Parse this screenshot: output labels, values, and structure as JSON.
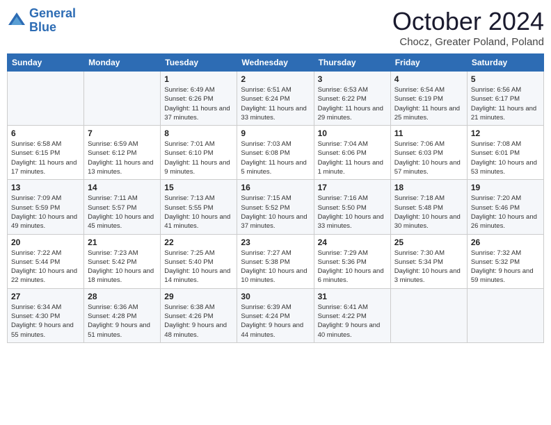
{
  "logo": {
    "line1": "General",
    "line2": "Blue"
  },
  "title": "October 2024",
  "subtitle": "Chocz, Greater Poland, Poland",
  "days_header": [
    "Sunday",
    "Monday",
    "Tuesday",
    "Wednesday",
    "Thursday",
    "Friday",
    "Saturday"
  ],
  "weeks": [
    [
      {
        "day": "",
        "info": ""
      },
      {
        "day": "",
        "info": ""
      },
      {
        "day": "1",
        "info": "Sunrise: 6:49 AM\nSunset: 6:26 PM\nDaylight: 11 hours and 37 minutes."
      },
      {
        "day": "2",
        "info": "Sunrise: 6:51 AM\nSunset: 6:24 PM\nDaylight: 11 hours and 33 minutes."
      },
      {
        "day": "3",
        "info": "Sunrise: 6:53 AM\nSunset: 6:22 PM\nDaylight: 11 hours and 29 minutes."
      },
      {
        "day": "4",
        "info": "Sunrise: 6:54 AM\nSunset: 6:19 PM\nDaylight: 11 hours and 25 minutes."
      },
      {
        "day": "5",
        "info": "Sunrise: 6:56 AM\nSunset: 6:17 PM\nDaylight: 11 hours and 21 minutes."
      }
    ],
    [
      {
        "day": "6",
        "info": "Sunrise: 6:58 AM\nSunset: 6:15 PM\nDaylight: 11 hours and 17 minutes."
      },
      {
        "day": "7",
        "info": "Sunrise: 6:59 AM\nSunset: 6:12 PM\nDaylight: 11 hours and 13 minutes."
      },
      {
        "day": "8",
        "info": "Sunrise: 7:01 AM\nSunset: 6:10 PM\nDaylight: 11 hours and 9 minutes."
      },
      {
        "day": "9",
        "info": "Sunrise: 7:03 AM\nSunset: 6:08 PM\nDaylight: 11 hours and 5 minutes."
      },
      {
        "day": "10",
        "info": "Sunrise: 7:04 AM\nSunset: 6:06 PM\nDaylight: 11 hours and 1 minute."
      },
      {
        "day": "11",
        "info": "Sunrise: 7:06 AM\nSunset: 6:03 PM\nDaylight: 10 hours and 57 minutes."
      },
      {
        "day": "12",
        "info": "Sunrise: 7:08 AM\nSunset: 6:01 PM\nDaylight: 10 hours and 53 minutes."
      }
    ],
    [
      {
        "day": "13",
        "info": "Sunrise: 7:09 AM\nSunset: 5:59 PM\nDaylight: 10 hours and 49 minutes."
      },
      {
        "day": "14",
        "info": "Sunrise: 7:11 AM\nSunset: 5:57 PM\nDaylight: 10 hours and 45 minutes."
      },
      {
        "day": "15",
        "info": "Sunrise: 7:13 AM\nSunset: 5:55 PM\nDaylight: 10 hours and 41 minutes."
      },
      {
        "day": "16",
        "info": "Sunrise: 7:15 AM\nSunset: 5:52 PM\nDaylight: 10 hours and 37 minutes."
      },
      {
        "day": "17",
        "info": "Sunrise: 7:16 AM\nSunset: 5:50 PM\nDaylight: 10 hours and 33 minutes."
      },
      {
        "day": "18",
        "info": "Sunrise: 7:18 AM\nSunset: 5:48 PM\nDaylight: 10 hours and 30 minutes."
      },
      {
        "day": "19",
        "info": "Sunrise: 7:20 AM\nSunset: 5:46 PM\nDaylight: 10 hours and 26 minutes."
      }
    ],
    [
      {
        "day": "20",
        "info": "Sunrise: 7:22 AM\nSunset: 5:44 PM\nDaylight: 10 hours and 22 minutes."
      },
      {
        "day": "21",
        "info": "Sunrise: 7:23 AM\nSunset: 5:42 PM\nDaylight: 10 hours and 18 minutes."
      },
      {
        "day": "22",
        "info": "Sunrise: 7:25 AM\nSunset: 5:40 PM\nDaylight: 10 hours and 14 minutes."
      },
      {
        "day": "23",
        "info": "Sunrise: 7:27 AM\nSunset: 5:38 PM\nDaylight: 10 hours and 10 minutes."
      },
      {
        "day": "24",
        "info": "Sunrise: 7:29 AM\nSunset: 5:36 PM\nDaylight: 10 hours and 6 minutes."
      },
      {
        "day": "25",
        "info": "Sunrise: 7:30 AM\nSunset: 5:34 PM\nDaylight: 10 hours and 3 minutes."
      },
      {
        "day": "26",
        "info": "Sunrise: 7:32 AM\nSunset: 5:32 PM\nDaylight: 9 hours and 59 minutes."
      }
    ],
    [
      {
        "day": "27",
        "info": "Sunrise: 6:34 AM\nSunset: 4:30 PM\nDaylight: 9 hours and 55 minutes."
      },
      {
        "day": "28",
        "info": "Sunrise: 6:36 AM\nSunset: 4:28 PM\nDaylight: 9 hours and 51 minutes."
      },
      {
        "day": "29",
        "info": "Sunrise: 6:38 AM\nSunset: 4:26 PM\nDaylight: 9 hours and 48 minutes."
      },
      {
        "day": "30",
        "info": "Sunrise: 6:39 AM\nSunset: 4:24 PM\nDaylight: 9 hours and 44 minutes."
      },
      {
        "day": "31",
        "info": "Sunrise: 6:41 AM\nSunset: 4:22 PM\nDaylight: 9 hours and 40 minutes."
      },
      {
        "day": "",
        "info": ""
      },
      {
        "day": "",
        "info": ""
      }
    ]
  ]
}
